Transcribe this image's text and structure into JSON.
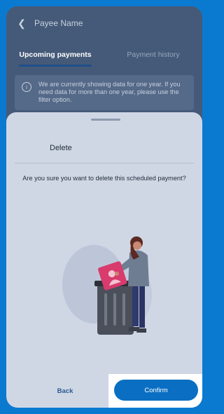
{
  "header": {
    "back_icon": "chevron-left-icon",
    "title": "Payee Name"
  },
  "tabs": [
    {
      "label": "Upcoming payments",
      "active": true
    },
    {
      "label": "Payment history",
      "active": false
    }
  ],
  "info_banner": {
    "icon": "info-icon",
    "text": "We are currently showing data for one year. If you need data for more than one year, please use the filter option."
  },
  "dialog": {
    "title": "Delete",
    "message": "Are you sure you want to delete this scheduled payment?",
    "illustration": "person-deleting-card-illustration",
    "buttons": {
      "back_label": "Back",
      "confirm_label": "Confirm"
    }
  },
  "colors": {
    "page_background": "#0a7ad1",
    "dimmed_background": "#455a78",
    "sheet_background": "#cfd7e5",
    "primary_button": "#0a6fc2",
    "link_text": "#2a5a93",
    "card_accent": "#d83b6c"
  }
}
